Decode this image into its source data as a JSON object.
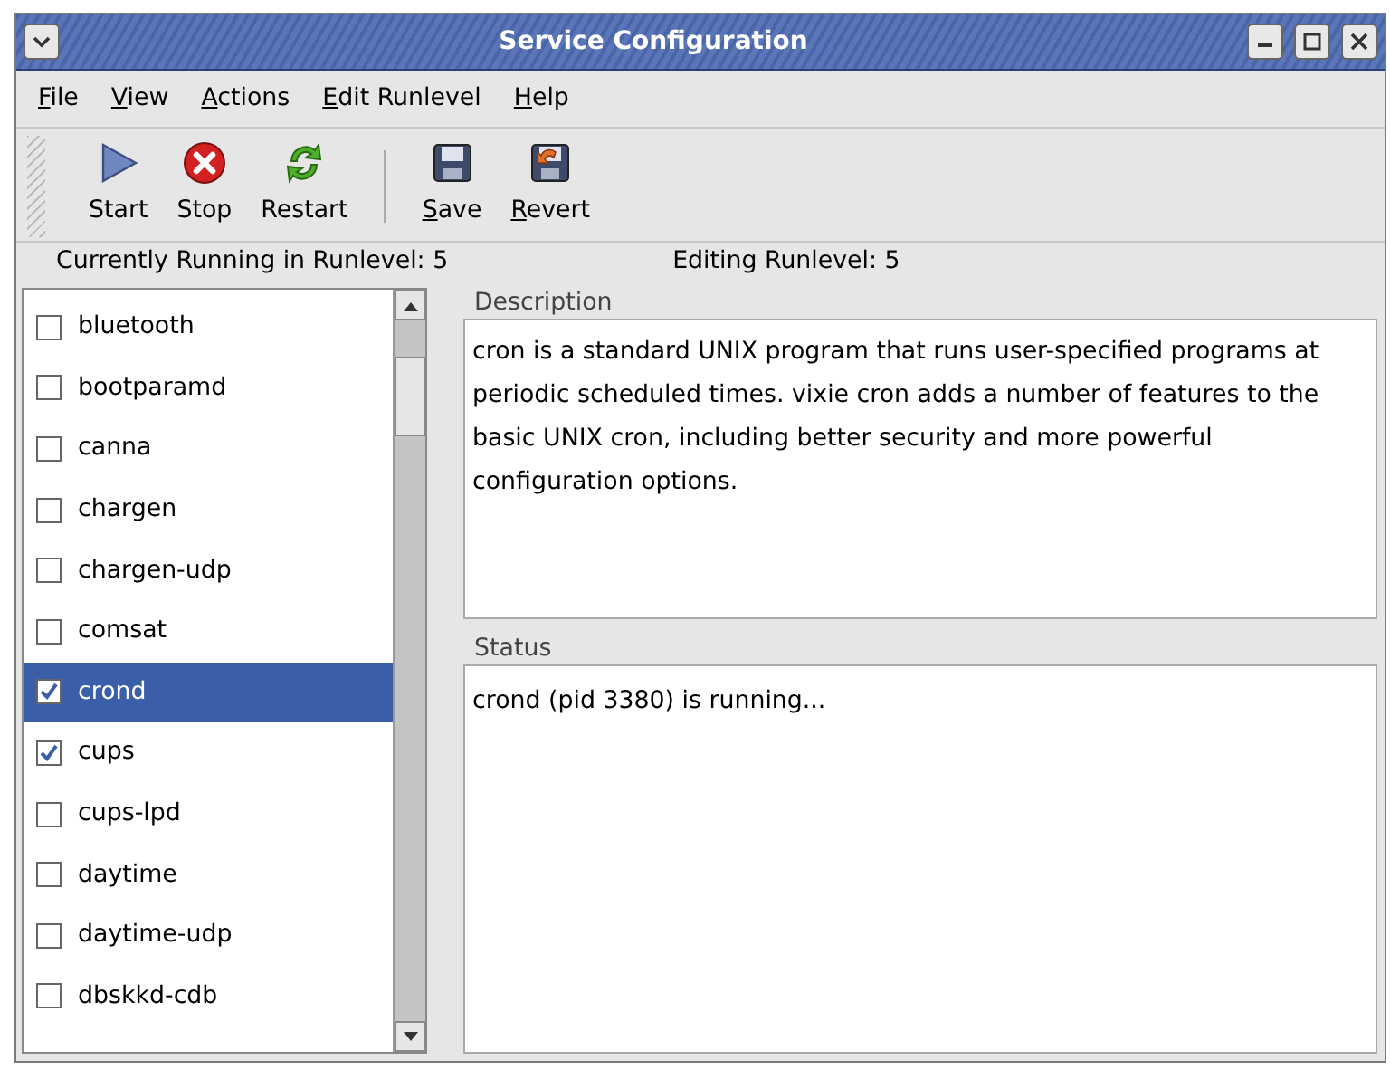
{
  "window": {
    "title": "Service Configuration"
  },
  "menu": [
    {
      "label": "File"
    },
    {
      "label": "View"
    },
    {
      "label": "Actions"
    },
    {
      "label": "Edit Runlevel"
    },
    {
      "label": "Help"
    }
  ],
  "toolbar": [
    {
      "kind": "start",
      "label": "Start",
      "mnemonic": false
    },
    {
      "kind": "stop",
      "label": "Stop",
      "mnemonic": false
    },
    {
      "kind": "restart",
      "label": "Restart",
      "mnemonic": false
    },
    {
      "kind": "separator"
    },
    {
      "kind": "save",
      "label": "Save",
      "mnemonic": true
    },
    {
      "kind": "revert",
      "label": "Revert",
      "mnemonic": true
    }
  ],
  "runlevel": {
    "current": "Currently Running in Runlevel: 5",
    "editing": "Editing Runlevel: 5"
  },
  "services": [
    {
      "name": "bluetooth",
      "checked": false,
      "selected": false
    },
    {
      "name": "bootparamd",
      "checked": false,
      "selected": false
    },
    {
      "name": "canna",
      "checked": false,
      "selected": false
    },
    {
      "name": "chargen",
      "checked": false,
      "selected": false
    },
    {
      "name": "chargen-udp",
      "checked": false,
      "selected": false
    },
    {
      "name": "comsat",
      "checked": false,
      "selected": false
    },
    {
      "name": "crond",
      "checked": true,
      "selected": true
    },
    {
      "name": "cups",
      "checked": true,
      "selected": false
    },
    {
      "name": "cups-lpd",
      "checked": false,
      "selected": false
    },
    {
      "name": "daytime",
      "checked": false,
      "selected": false
    },
    {
      "name": "daytime-udp",
      "checked": false,
      "selected": false
    },
    {
      "name": "dbskkd-cdb",
      "checked": false,
      "selected": false
    }
  ],
  "description": {
    "label": "Description",
    "text": "cron is a standard UNIX program that runs user-specified programs at periodic scheduled times. vixie cron adds a number of features to the basic UNIX cron, including better security and more powerful configuration options."
  },
  "status": {
    "label": "Status",
    "text": "crond (pid 3380) is running..."
  }
}
